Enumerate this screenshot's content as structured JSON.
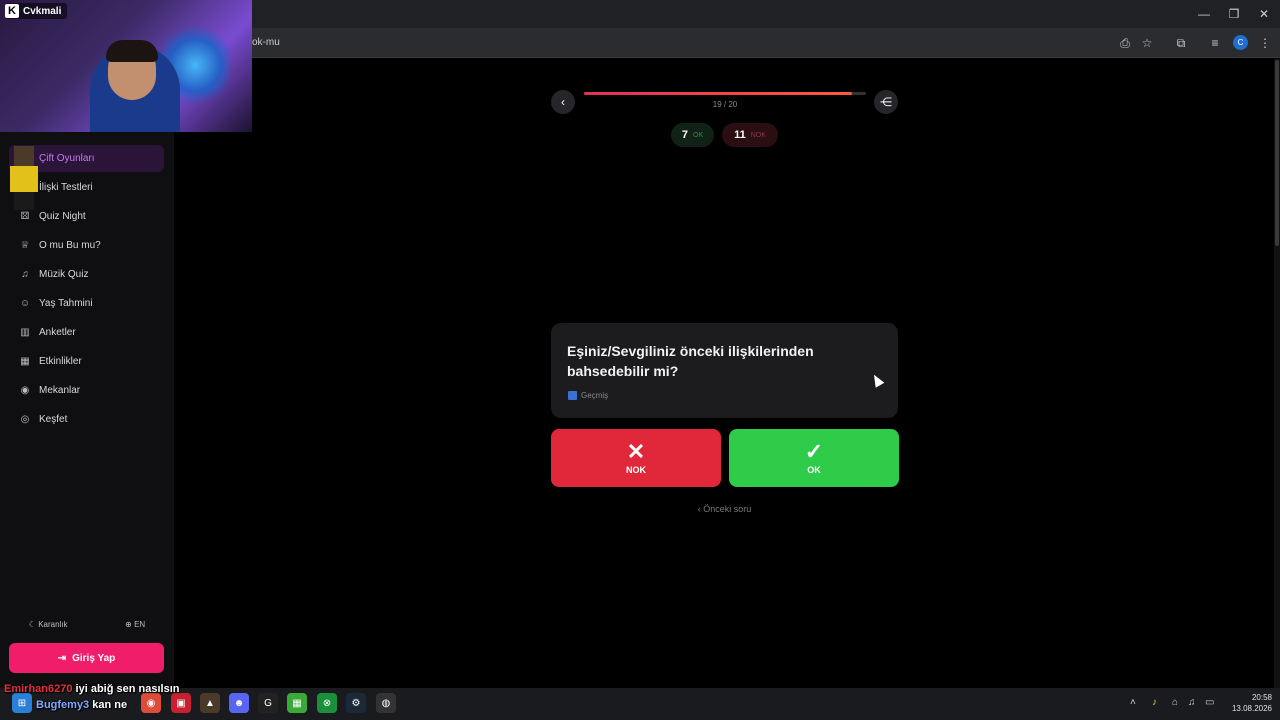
{
  "browser": {
    "url_fragment": "ok-mu",
    "profile_initial": "C"
  },
  "stream": {
    "channel_badge": "K",
    "channel_name": "Cvkmali"
  },
  "sidebar": {
    "items": [
      {
        "label": "Çift Oyunları",
        "icon": "heart-icon",
        "active": true
      },
      {
        "label": "İlişki Testleri",
        "icon": "heart-test-icon",
        "active": false
      },
      {
        "label": "Quiz Night",
        "icon": "dice-icon",
        "active": false
      },
      {
        "label": "O mu Bu mu?",
        "icon": "trophy-icon",
        "active": false
      },
      {
        "label": "Müzik Quiz",
        "icon": "headphones-icon",
        "active": false
      },
      {
        "label": "Yaş Tahmini",
        "icon": "baby-icon",
        "active": false
      },
      {
        "label": "Anketler",
        "icon": "bar-chart-icon",
        "active": false
      },
      {
        "label": "Etkinlikler",
        "icon": "calendar-icon",
        "active": false
      },
      {
        "label": "Mekanlar",
        "icon": "map-pin-icon",
        "active": false
      },
      {
        "label": "Keşfet",
        "icon": "compass-icon",
        "active": false
      }
    ],
    "theme_label": "Karanlık",
    "lang_label": "EN",
    "login_label": "Giriş Yap"
  },
  "quiz": {
    "progress_text": "19 / 20",
    "progress_fraction": 0.95,
    "score_ok_count": "7",
    "score_ok_label": "OK",
    "score_nok_count": "11",
    "score_nok_label": "NOK",
    "question": "Eşiniz/Sevgiliniz önceki ilişkilerinden bahsedebilir mi?",
    "category": "Geçmiş",
    "nok_symbol": "✕",
    "nok_label": "NOK",
    "ok_symbol": "✓",
    "ok_label": "OK",
    "previous_label": "Önceki soru"
  },
  "chat": [
    {
      "user": "Emirhan6270",
      "message": "iyi abiğ sen nasılsın"
    },
    {
      "user": "Bugfemy3",
      "message": "kan ne"
    }
  ],
  "taskbar": {
    "time": "20:58",
    "date": "13.08.2026"
  },
  "colors": {
    "accent_pink": "#f01e6a",
    "nok_red": "#e0283a",
    "ok_green": "#2fcc4a",
    "active_purple": "#c778f0"
  }
}
